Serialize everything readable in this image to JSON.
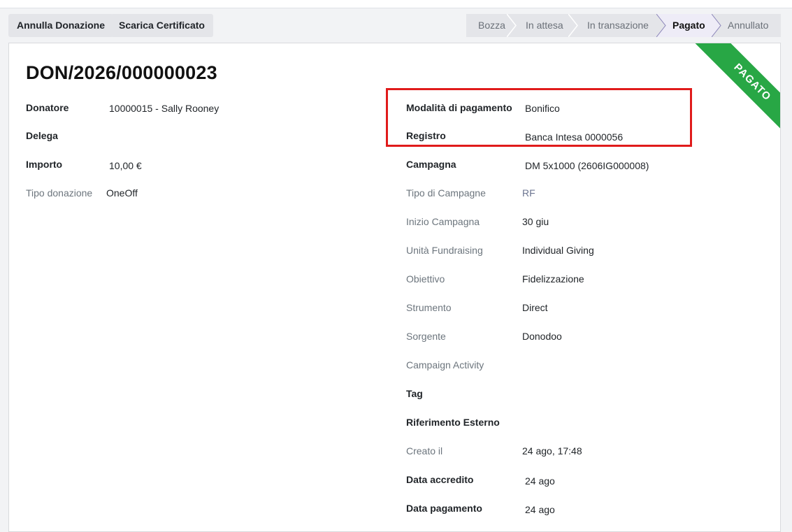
{
  "actions": {
    "cancel_label": "Annulla Donazione",
    "certificate_label": "Scarica Certificato"
  },
  "statusbar": {
    "stages": [
      "Bozza",
      "In attesa",
      "In transazione",
      "Pagato",
      "Annullato"
    ],
    "active": "Pagato"
  },
  "record": {
    "title": "DON/2026/000000023",
    "ribbon": "PAGATO"
  },
  "left_fields": [
    {
      "label": "Donatore",
      "value": "10000015 - Sally Rooney"
    },
    {
      "label": "Delega",
      "value": ""
    },
    {
      "label": "Importo",
      "value": "10,00 €"
    },
    {
      "label": "Tipo donazione",
      "value": "OneOff"
    }
  ],
  "right_fields": [
    {
      "label": "Modalità di pagamento",
      "value": "Bonifico"
    },
    {
      "label": "Registro",
      "value": "Banca Intesa 0000056"
    },
    {
      "label": "Campagna",
      "value": "DM 5x1000 (2606IG000008)"
    },
    {
      "label": "Tipo di Campagne",
      "value": "RF"
    },
    {
      "label": "Inizio Campagna",
      "value": "30 giu"
    },
    {
      "label": "Unità Fundraising",
      "value": "Individual Giving"
    },
    {
      "label": "Obiettivo",
      "value": "Fidelizzazione"
    },
    {
      "label": "Strumento",
      "value": "Direct"
    },
    {
      "label": "Sorgente",
      "value": "Donodoo"
    },
    {
      "label": "Campaign Activity",
      "value": ""
    },
    {
      "label": "Tag",
      "value": ""
    },
    {
      "label": "Riferimento Esterno",
      "value": ""
    },
    {
      "label": "Creato il",
      "value": "24 ago, 17:48"
    },
    {
      "label": "Data accredito",
      "value": "24 ago"
    },
    {
      "label": "Data pagamento",
      "value": "24 ago"
    }
  ],
  "colors": {
    "ribbon": "#28a745",
    "highlight_border": "#e01b1b",
    "active_stage_bg": "#eeecf7"
  }
}
